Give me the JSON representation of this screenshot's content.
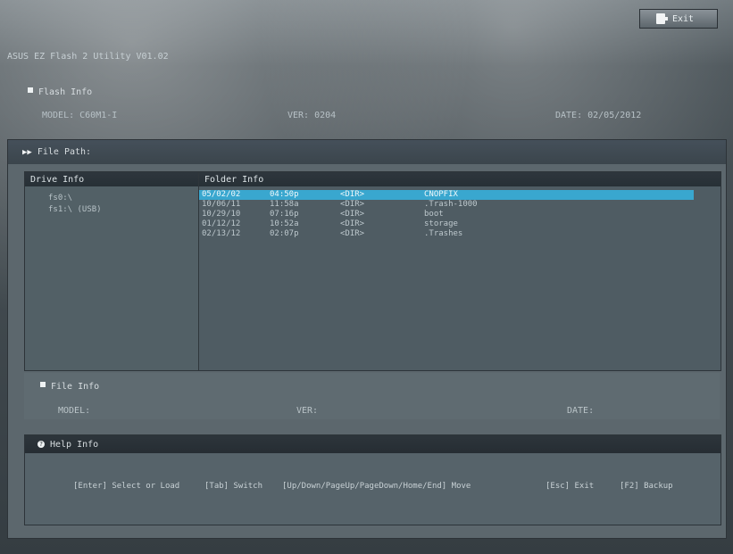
{
  "header": {
    "exit_label": "Exit",
    "app_title": "ASUS EZ Flash 2 Utility V01.02"
  },
  "flash_info": {
    "title": "Flash Info",
    "model": "MODEL: C60M1-I",
    "ver": "VER: 0204",
    "date": "DATE: 02/05/2012"
  },
  "file_path": {
    "label": "File Path:"
  },
  "drive_info": {
    "title": "Drive Info",
    "items": [
      "fs0:\\",
      "fs1:\\ (USB)"
    ]
  },
  "folder_info": {
    "title": "Folder Info",
    "rows": [
      {
        "date": "05/02/02",
        "time": "04:50p",
        "type": "<DIR>",
        "name": "CNOPFIX",
        "selected": true
      },
      {
        "date": "10/06/11",
        "time": "11:58a",
        "type": "<DIR>",
        "name": ".Trash-1000",
        "selected": false
      },
      {
        "date": "10/29/10",
        "time": "07:16p",
        "type": "<DIR>",
        "name": "boot",
        "selected": false
      },
      {
        "date": "01/12/12",
        "time": "10:52a",
        "type": "<DIR>",
        "name": "storage",
        "selected": false
      },
      {
        "date": "02/13/12",
        "time": "02:07p",
        "type": "<DIR>",
        "name": ".Trashes",
        "selected": false
      }
    ]
  },
  "file_info": {
    "title": "File Info",
    "model": "MODEL:",
    "ver": "VER:",
    "date": "DATE:"
  },
  "help_info": {
    "title": "Help Info",
    "items": [
      "[Enter] Select or Load",
      "[Tab] Switch",
      "[Up/Down/PageUp/PageDown/Home/End] Move",
      "[Esc] Exit",
      "[F2] Backup"
    ]
  }
}
